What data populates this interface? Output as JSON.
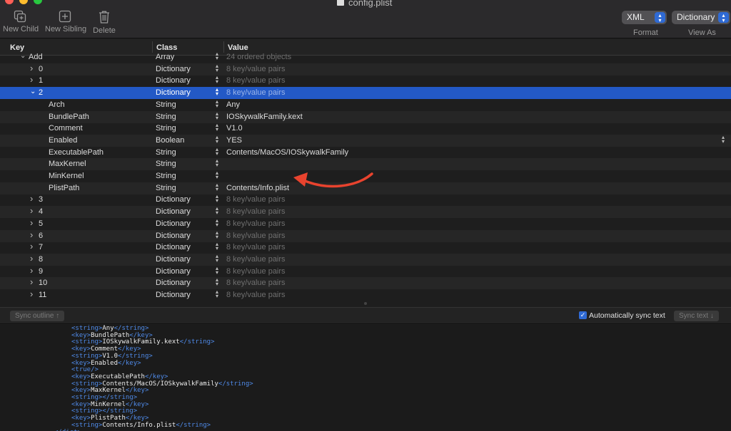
{
  "window": {
    "title": "config.plist"
  },
  "toolbar": {
    "new_child": "New Child",
    "new_sibling": "New Sibling",
    "delete": "Delete",
    "format_value": "XML",
    "format_label": "Format",
    "view_value": "Dictionary",
    "view_label": "View As"
  },
  "columns": {
    "key": "Key",
    "class": "Class",
    "value": "Value"
  },
  "rows": [
    {
      "key": "Add",
      "class": "Array",
      "value": "24 ordered objects",
      "dim": true,
      "indent": 0,
      "disclosure": "expanded"
    },
    {
      "key": "0",
      "class": "Dictionary",
      "value": "8 key/value pairs",
      "dim": true,
      "indent": 1,
      "disclosure": "collapsed"
    },
    {
      "key": "1",
      "class": "Dictionary",
      "value": "8 key/value pairs",
      "dim": true,
      "indent": 1,
      "disclosure": "collapsed"
    },
    {
      "key": "2",
      "class": "Dictionary",
      "value": "8 key/value pairs",
      "dim": true,
      "indent": 1,
      "disclosure": "expanded",
      "selected": true
    },
    {
      "key": "Arch",
      "class": "String",
      "value": "Any",
      "indent": 2
    },
    {
      "key": "BundlePath",
      "class": "String",
      "value": "IOSkywalkFamily.kext",
      "indent": 2
    },
    {
      "key": "Comment",
      "class": "String",
      "value": "V1.0",
      "indent": 2
    },
    {
      "key": "Enabled",
      "class": "Boolean",
      "value": "YES",
      "indent": 2,
      "value_stepper": true
    },
    {
      "key": "ExecutablePath",
      "class": "String",
      "value": "Contents/MacOS/IOSkywalkFamily",
      "indent": 2
    },
    {
      "key": "MaxKernel",
      "class": "String",
      "value": "",
      "indent": 2
    },
    {
      "key": "MinKernel",
      "class": "String",
      "value": "",
      "indent": 2
    },
    {
      "key": "PlistPath",
      "class": "String",
      "value": "Contents/Info.plist",
      "indent": 2
    },
    {
      "key": "3",
      "class": "Dictionary",
      "value": "8 key/value pairs",
      "dim": true,
      "indent": 1,
      "disclosure": "collapsed"
    },
    {
      "key": "4",
      "class": "Dictionary",
      "value": "8 key/value pairs",
      "dim": true,
      "indent": 1,
      "disclosure": "collapsed"
    },
    {
      "key": "5",
      "class": "Dictionary",
      "value": "8 key/value pairs",
      "dim": true,
      "indent": 1,
      "disclosure": "collapsed"
    },
    {
      "key": "6",
      "class": "Dictionary",
      "value": "8 key/value pairs",
      "dim": true,
      "indent": 1,
      "disclosure": "collapsed"
    },
    {
      "key": "7",
      "class": "Dictionary",
      "value": "8 key/value pairs",
      "dim": true,
      "indent": 1,
      "disclosure": "collapsed"
    },
    {
      "key": "8",
      "class": "Dictionary",
      "value": "8 key/value pairs",
      "dim": true,
      "indent": 1,
      "disclosure": "collapsed"
    },
    {
      "key": "9",
      "class": "Dictionary",
      "value": "8 key/value pairs",
      "dim": true,
      "indent": 1,
      "disclosure": "collapsed"
    },
    {
      "key": "10",
      "class": "Dictionary",
      "value": "8 key/value pairs",
      "dim": true,
      "indent": 1,
      "disclosure": "collapsed"
    },
    {
      "key": "11",
      "class": "Dictionary",
      "value": "8 key/value pairs",
      "dim": true,
      "indent": 1,
      "disclosure": "collapsed"
    }
  ],
  "sync": {
    "outline_button": "Sync outline ↑",
    "auto_label": "Automatically sync text",
    "auto_checked": true,
    "text_button": "Sync text ↓"
  },
  "xml_lines": [
    {
      "indent": 1,
      "parts": [
        [
          "t",
          "<string>"
        ],
        [
          "x",
          "Any"
        ],
        [
          "t",
          "</string>"
        ]
      ]
    },
    {
      "indent": 1,
      "parts": [
        [
          "t",
          "<key>"
        ],
        [
          "x",
          "BundlePath"
        ],
        [
          "t",
          "</key>"
        ]
      ]
    },
    {
      "indent": 1,
      "parts": [
        [
          "t",
          "<string>"
        ],
        [
          "x",
          "IOSkywalkFamily.kext"
        ],
        [
          "t",
          "</string>"
        ]
      ]
    },
    {
      "indent": 1,
      "parts": [
        [
          "t",
          "<key>"
        ],
        [
          "x",
          "Comment"
        ],
        [
          "t",
          "</key>"
        ]
      ]
    },
    {
      "indent": 1,
      "parts": [
        [
          "t",
          "<string>"
        ],
        [
          "x",
          "V1.0"
        ],
        [
          "t",
          "</string>"
        ]
      ]
    },
    {
      "indent": 1,
      "parts": [
        [
          "t",
          "<key>"
        ],
        [
          "x",
          "Enabled"
        ],
        [
          "t",
          "</key>"
        ]
      ]
    },
    {
      "indent": 1,
      "parts": [
        [
          "t",
          "<true/>"
        ]
      ]
    },
    {
      "indent": 1,
      "parts": [
        [
          "t",
          "<key>"
        ],
        [
          "x",
          "ExecutablePath"
        ],
        [
          "t",
          "</key>"
        ]
      ]
    },
    {
      "indent": 1,
      "parts": [
        [
          "t",
          "<string>"
        ],
        [
          "x",
          "Contents/MacOS/IOSkywalkFamily"
        ],
        [
          "t",
          "</string>"
        ]
      ]
    },
    {
      "indent": 1,
      "parts": [
        [
          "t",
          "<key>"
        ],
        [
          "x",
          "MaxKernel"
        ],
        [
          "t",
          "</key>"
        ]
      ]
    },
    {
      "indent": 1,
      "parts": [
        [
          "t",
          "<string></string>"
        ]
      ]
    },
    {
      "indent": 1,
      "parts": [
        [
          "t",
          "<key>"
        ],
        [
          "x",
          "MinKernel"
        ],
        [
          "t",
          "</key>"
        ]
      ]
    },
    {
      "indent": 1,
      "parts": [
        [
          "t",
          "<string></string>"
        ]
      ]
    },
    {
      "indent": 1,
      "parts": [
        [
          "t",
          "<key>"
        ],
        [
          "x",
          "PlistPath"
        ],
        [
          "t",
          "</key>"
        ]
      ]
    },
    {
      "indent": 1,
      "parts": [
        [
          "t",
          "<string>"
        ],
        [
          "x",
          "Contents/Info.plist"
        ],
        [
          "t",
          "</string>"
        ]
      ]
    },
    {
      "indent": 0,
      "parts": [
        [
          "t",
          "</dict>"
        ]
      ]
    }
  ],
  "colors": {
    "selection": "#2359c6",
    "xml_tag": "#4f8ae8",
    "annotation_arrow": "#e8432e"
  }
}
